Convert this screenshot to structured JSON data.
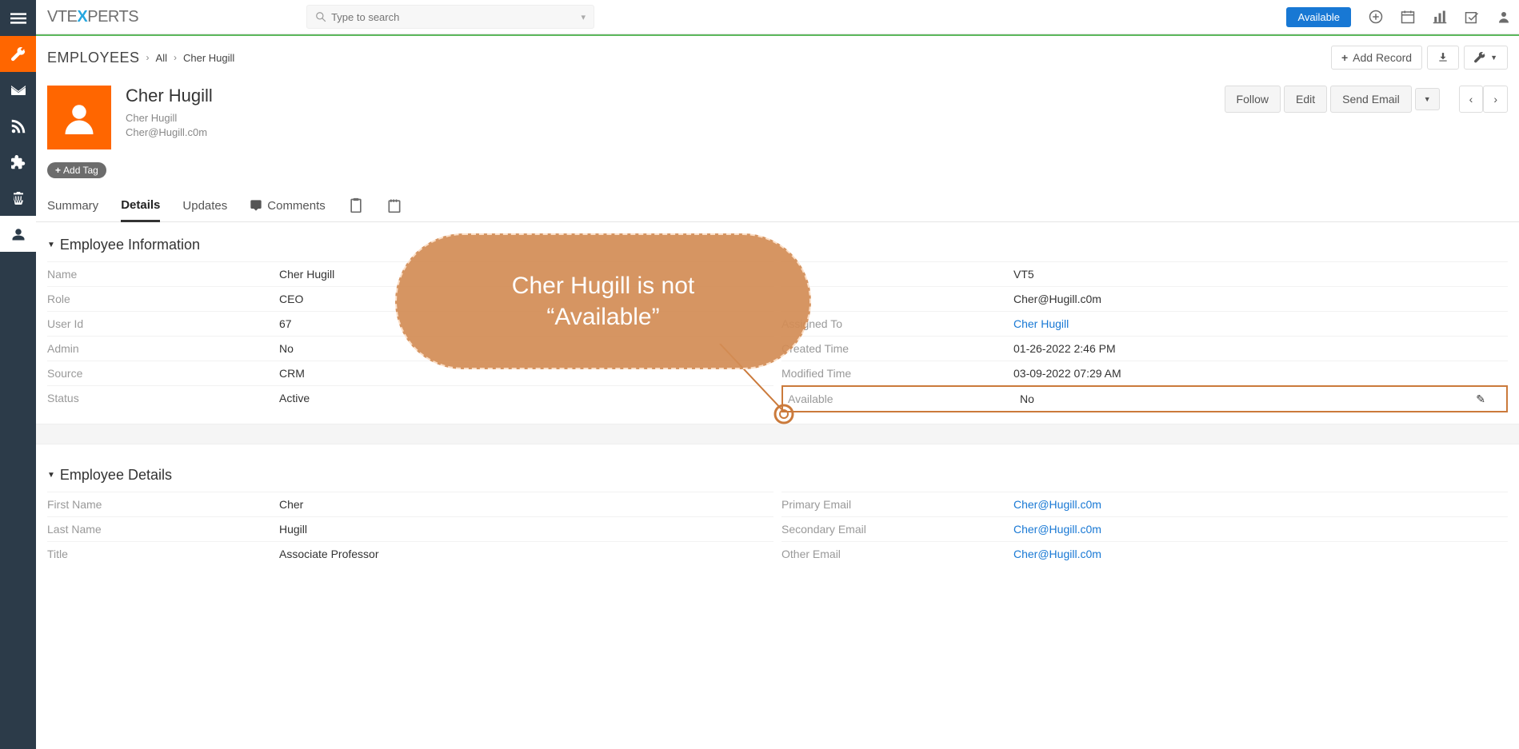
{
  "header": {
    "logo_pre": "VTE",
    "logo_x": "X",
    "logo_post": "PERTS",
    "search_placeholder": "Type to search",
    "available_button": "Available"
  },
  "breadcrumb": {
    "module": "EMPLOYEES",
    "link1": "All",
    "current": "Cher Hugill",
    "add_record": "Add Record"
  },
  "record": {
    "title": "Cher Hugill",
    "subtitle": "Cher Hugill",
    "email": "Cher@Hugill.c0m",
    "add_tag": "Add Tag",
    "follow": "Follow",
    "edit": "Edit",
    "send_email": "Send Email"
  },
  "tabs": {
    "summary": "Summary",
    "details": "Details",
    "updates": "Updates",
    "comments": "Comments"
  },
  "section_info": {
    "title": "Employee Information",
    "left": [
      {
        "label": "Name",
        "value": "Cher Hugill"
      },
      {
        "label": "Role",
        "value": "CEO"
      },
      {
        "label": "User Id",
        "value": "67"
      },
      {
        "label": "Admin",
        "value": "No"
      },
      {
        "label": "Source",
        "value": "CRM"
      },
      {
        "label": "Status",
        "value": "Active"
      }
    ],
    "right": [
      {
        "label": "",
        "value": "VT5"
      },
      {
        "label": "",
        "value": "Cher@Hugill.c0m"
      },
      {
        "label": "Assigned To",
        "value": "Cher Hugill",
        "link": true
      },
      {
        "label": "Created Time",
        "value": "01-26-2022 2:46 PM"
      },
      {
        "label": "Modified Time",
        "value": "03-09-2022 07:29 AM"
      },
      {
        "label": "Available",
        "value": "No",
        "highlight": true
      }
    ]
  },
  "section_details": {
    "title": "Employee Details",
    "left": [
      {
        "label": "First Name",
        "value": "Cher"
      },
      {
        "label": "Last Name",
        "value": "Hugill"
      },
      {
        "label": "Title",
        "value": "Associate Professor"
      }
    ],
    "right": [
      {
        "label": "Primary Email",
        "value": "Cher@Hugill.c0m",
        "link": true
      },
      {
        "label": "Secondary Email",
        "value": "Cher@Hugill.c0m",
        "link": true
      },
      {
        "label": "Other Email",
        "value": "Cher@Hugill.c0m",
        "link": true
      }
    ]
  },
  "callout": {
    "text_line1": "Cher Hugill is not",
    "text_line2": "“Available”"
  }
}
